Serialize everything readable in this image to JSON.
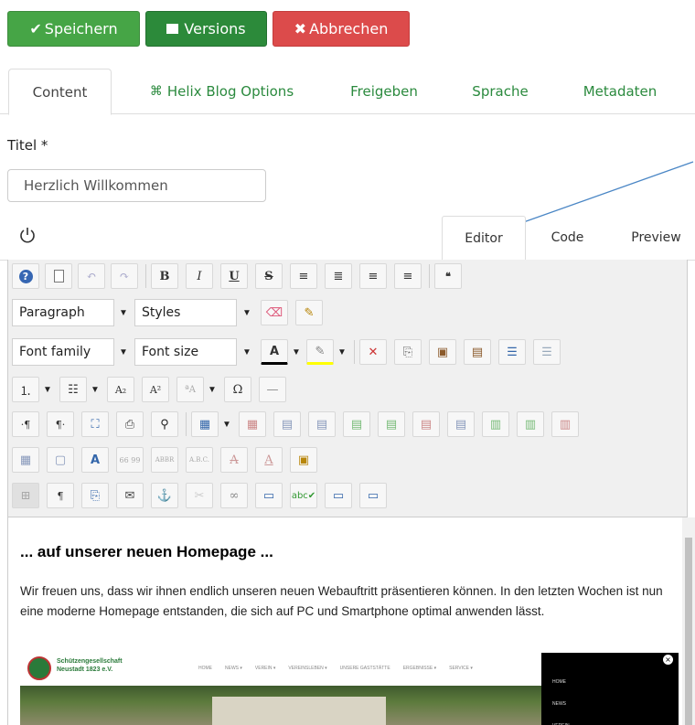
{
  "toolbar_actions": {
    "save_label": "Speichern",
    "versions_label": "Versions",
    "cancel_label": "Abbrechen"
  },
  "tabs": [
    {
      "label": "Content"
    },
    {
      "label": "Helix Blog Options"
    },
    {
      "label": "Freigeben"
    },
    {
      "label": "Sprache"
    },
    {
      "label": "Metadaten"
    }
  ],
  "title_field": {
    "label": "Titel *",
    "value": "Herzlich Willkommen"
  },
  "editor_tabs": [
    {
      "label": "Editor"
    },
    {
      "label": "Code"
    },
    {
      "label": "Preview"
    }
  ],
  "editor_toolbar": {
    "format_select": "Paragraph",
    "styles_select": "Styles",
    "font_family_select": "Font family",
    "font_size_select": "Font size"
  },
  "content": {
    "heading": "... auf unserer neuen Homepage ...",
    "paragraph": "Wir freuen uns, dass wir ihnen endlich unseren neuen Webauftritt präsentieren können. In den letzten Wochen ist nun eine moderne Homepage entstanden, die sich auf  PC und Smartphone optimal anwenden lässt.",
    "embedded_site": {
      "title_line1": "Schützengesellschaft",
      "title_line2": "Neustadt 1823 e.V.",
      "nav": [
        "HOME",
        "NEWS ▾",
        "VEREIN ▾",
        "VEREINSLEBEN ▾",
        "UNSERE GASTSTÄTTE",
        "ERGEBNISSE ▾",
        "SERVICE ▾"
      ],
      "side_nav": [
        "HOME",
        "NEWS",
        "VEREIN"
      ]
    }
  },
  "colors": {
    "save": "#46a546",
    "versions": "#2c8a3a",
    "cancel": "#dc4b4b",
    "tab_link": "#2b8a3e",
    "arrow": "#4a86c5"
  }
}
